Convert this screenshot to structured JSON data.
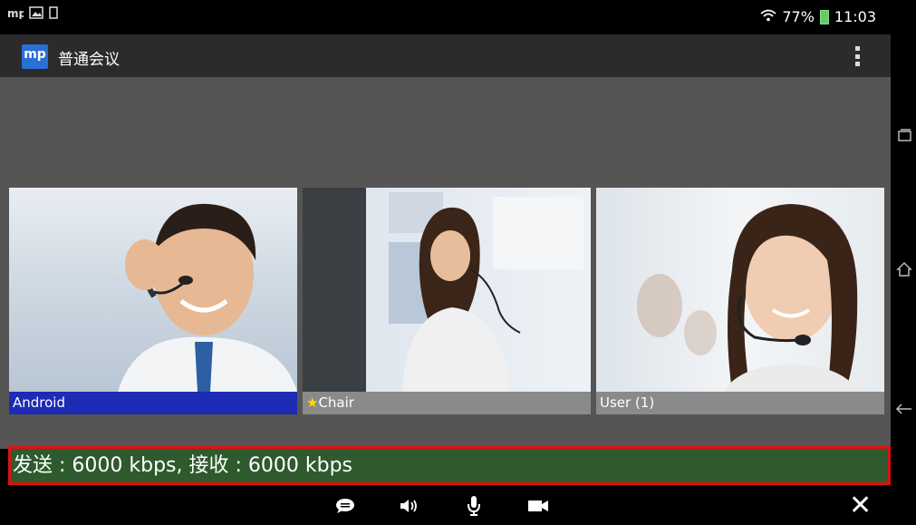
{
  "statusbar": {
    "left_icons": [
      "mp-app-icon",
      "image-icon",
      "tablet-icon"
    ],
    "battery": "77%",
    "time": "11:03"
  },
  "actionbar": {
    "logo": "mp",
    "title": "普通会议"
  },
  "participants": [
    {
      "name": "Android",
      "active": true,
      "chair": false
    },
    {
      "name": "Chair",
      "active": false,
      "chair": true
    },
    {
      "name": "User (1)",
      "active": false,
      "chair": false
    }
  ],
  "banner": {
    "text": "发送 : 6000 kbps,  接收 : 6000 kbps"
  },
  "toolbar": {
    "buttons": [
      "chat-icon",
      "speaker-icon",
      "microphone-icon",
      "camera-icon"
    ],
    "close": "✕"
  },
  "colors": {
    "active_label": "#1d2bb5",
    "banner_bg": "#2e5a2e",
    "banner_border": "#e01010"
  }
}
